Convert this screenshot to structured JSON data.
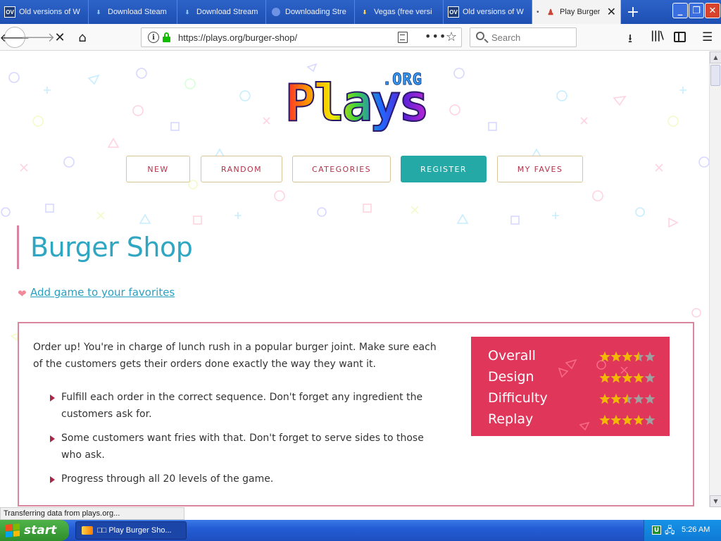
{
  "browser": {
    "tabs": [
      {
        "title": "Old versions of W",
        "icon": "ov-icon"
      },
      {
        "title": "Download Steam",
        "icon": "steam-icon"
      },
      {
        "title": "Download Stream",
        "icon": "steam-icon"
      },
      {
        "title": "Downloading Stre",
        "icon": "circle-icon"
      },
      {
        "title": "Vegas (free versi",
        "icon": "vegas-icon"
      },
      {
        "title": "Old versions of W",
        "icon": "ov-icon"
      },
      {
        "title": "Play Burger",
        "icon": "plays-icon",
        "active": true
      }
    ],
    "ov_badge": "OV",
    "url": "https://plays.org/burger-shop/",
    "search_placeholder": "Search",
    "status": "Transferring data from plays.org..."
  },
  "site": {
    "logo_main": "Plays",
    "logo_org": ".ORG",
    "nav": {
      "new": "NEW",
      "random": "RANDOM",
      "categories": "CATEGORIES",
      "register": "REGISTER",
      "faves": "MY FAVES"
    }
  },
  "game": {
    "title": "Burger Shop",
    "favorite_link": "Add game to your favorites",
    "intro": "Order up! You're in charge of lunch rush in a popular burger joint. Make sure each of the customers gets their orders done exactly the way they want it.",
    "features": [
      "Fulfill each order in the correct sequence. Don't forget any ingredient the customers ask for.",
      "Some customers want fries with that. Don't forget to serve sides to those who ask.",
      "Progress through all 20 levels of the game."
    ],
    "ratings": [
      {
        "label": "Overall",
        "stars": 3.5
      },
      {
        "label": "Design",
        "stars": 4
      },
      {
        "label": "Difficulty",
        "stars": 2.5
      },
      {
        "label": "Replay",
        "stars": 4
      }
    ]
  },
  "taskbar": {
    "start_label": "start",
    "task_label": "□□ Play Burger Sho...",
    "tray_app": "U",
    "clock": "5:26 AM"
  },
  "colors": {
    "accent_teal": "#25a9a6",
    "title_blue": "#2fa6c2",
    "ratings_bg": "#e0365a",
    "border_pink": "#d9869e",
    "star_gold": "#f5b800",
    "star_empty": "#a0a0a0"
  }
}
